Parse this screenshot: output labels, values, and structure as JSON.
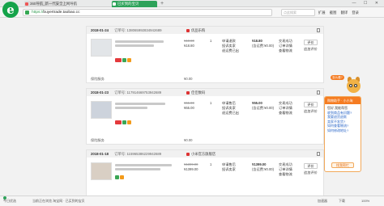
{
  "browser": {
    "tabs": [
      {
        "label": "360导航_新一代安全上网导航",
        "active": false
      },
      {
        "label": "已买到的宝贝",
        "active": true
      }
    ],
    "new_tab_symbol": "+",
    "window_controls": "— ☐ ✕",
    "address": {
      "badge": "淘宝",
      "protocol": "https://",
      "host": "buyertrade.taobao.cc",
      "rest": ""
    },
    "search_placeholder": "点此搜索",
    "tools": [
      "扩展",
      "截图",
      "翻译",
      "登录"
    ]
  },
  "orders": [
    {
      "date": "2018-01-24",
      "order_no_label": "订单号:",
      "order_no": "138065992834942689",
      "shop": "优品乐购",
      "price": "¥18.80",
      "orig_price": "¥18.80",
      "qty": "1",
      "service": [
        "申请退款",
        "投诉卖家",
        "退运费已出"
      ],
      "total": "¥18.80",
      "total_note": "(含运费:¥0.00)",
      "status": [
        "交易成功",
        "订单详情",
        "查看物流"
      ],
      "actions": [
        "评价",
        "追加评价"
      ],
      "extra_label": "保险服务",
      "extra_price": "¥0.00"
    },
    {
      "date": "2018-01-23",
      "order_no_label": "订单号:",
      "order_no": "117914669753942689",
      "shop": "佳佳数码",
      "price": "¥55.00",
      "orig_price": "¥55.00",
      "qty": "1",
      "service": [
        "申请售后",
        "投诉卖家",
        "退运费已出"
      ],
      "total": "¥55.00",
      "total_note": "(含运费:¥0.00)",
      "status": [
        "交易成功",
        "订单详情",
        "查看物流"
      ],
      "actions": [
        "评价",
        "追加评价"
      ],
      "extra_label": "保险服务",
      "extra_price": "¥0.00"
    },
    {
      "date": "2018-01-18",
      "order_no_label": "订单号:",
      "order_no": "115965386229942689",
      "shop": "小米官方旗舰店",
      "price": "¥1399.00",
      "orig_price": "¥1399.00",
      "qty": "1",
      "service": [
        "申请售后",
        "投诉卖家"
      ],
      "total": "¥1399.00",
      "total_note": "(含运费:¥0.00)",
      "status": [
        "交易成功",
        "订单详情",
        "查看物流"
      ],
      "actions": [
        "评价",
        "追加评价"
      ]
    }
  ],
  "helper": {
    "badge": "怎么看?",
    "header": "购物助手 · 小小淘",
    "questions": [
      "您好,我能帮您",
      "收到商品有问题?",
      "我要退货退款",
      "卖家不发货?",
      "如何查看物流?",
      "如何修改地址?"
    ],
    "button": "找我帮忙"
  },
  "statusbar": {
    "left": "今日优选",
    "notice": "当前正在浏览 淘宝网 · 已买到的宝贝",
    "right": [
      "加速器",
      "下载",
      "100%"
    ]
  }
}
